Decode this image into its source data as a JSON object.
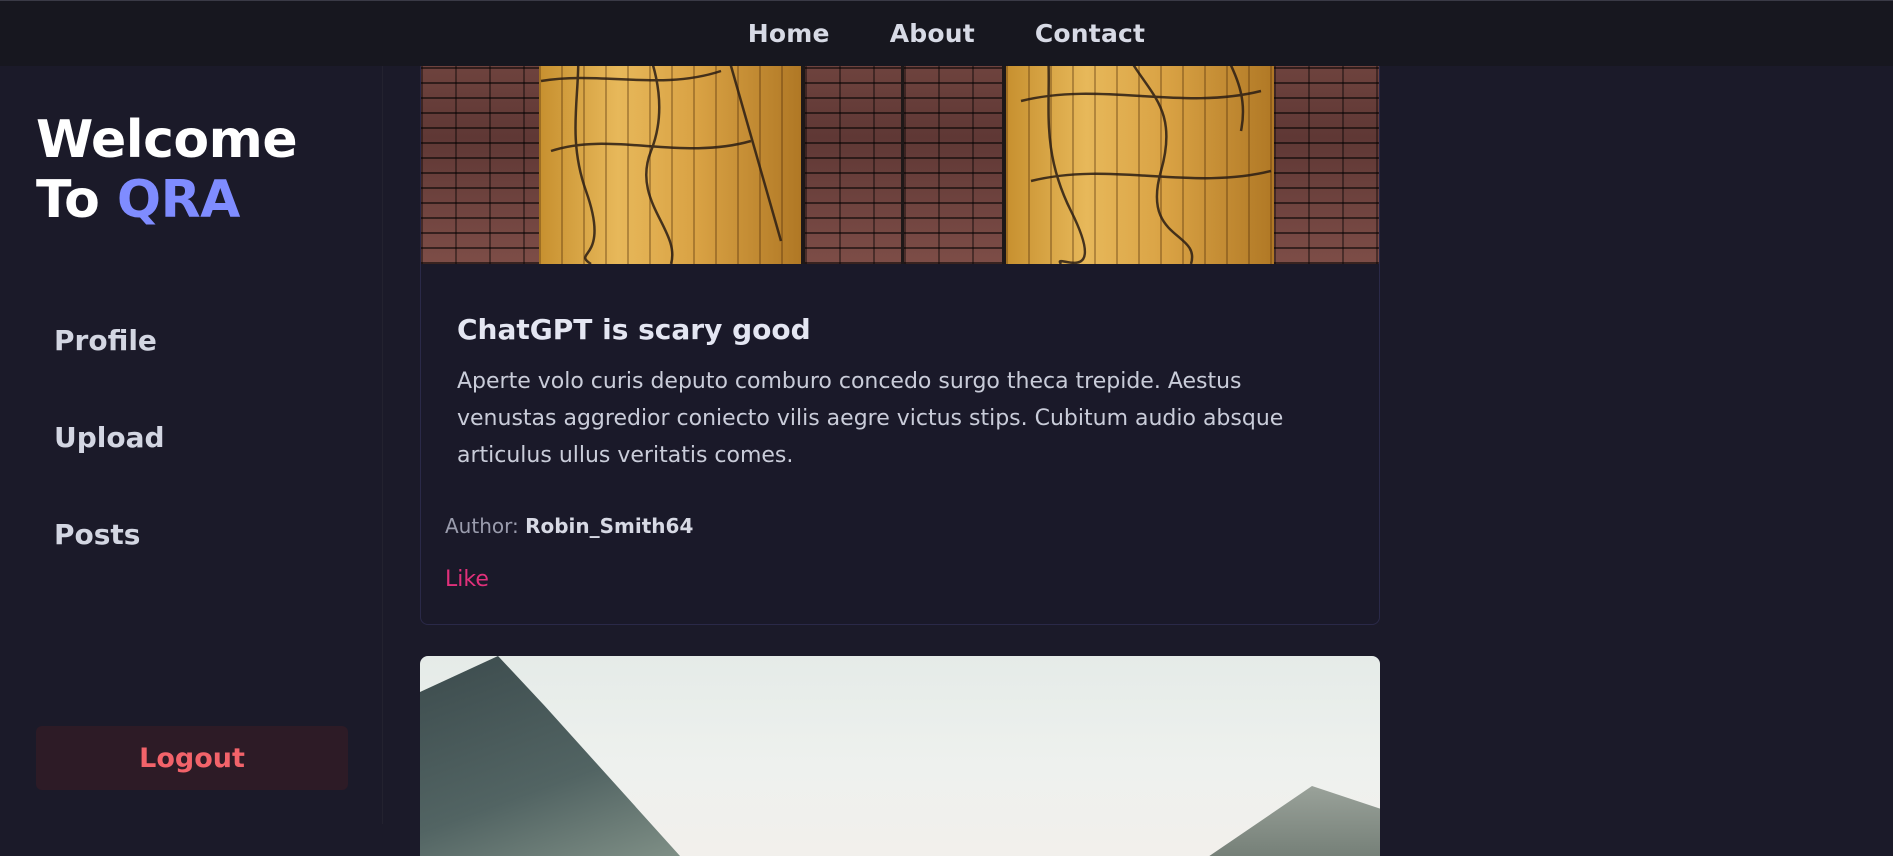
{
  "topnav": {
    "items": [
      "Home",
      "About",
      "Contact"
    ]
  },
  "sidebar": {
    "brand_line1": "Welcome",
    "brand_line2_prefix": "To ",
    "brand_accent": "QRA",
    "items": [
      "Profile",
      "Upload",
      "Posts"
    ],
    "logout_label": "Logout"
  },
  "posts": [
    {
      "title": "ChatGPT is scary good",
      "body": "Aperte volo curis deputo comburo concedo surgo theca trepide. Aestus venustas aggredior coniecto vilis aegre victus stips. Cubitum audio absque articulus ullus veritatis comes.",
      "author_label": "Author:",
      "author_name": "Robin_Smith64",
      "like_label": "Like"
    }
  ],
  "colors": {
    "background": "#1b1a29",
    "accent": "#7f8cff",
    "logout_text": "#f2636a",
    "like": "#e0307a"
  }
}
